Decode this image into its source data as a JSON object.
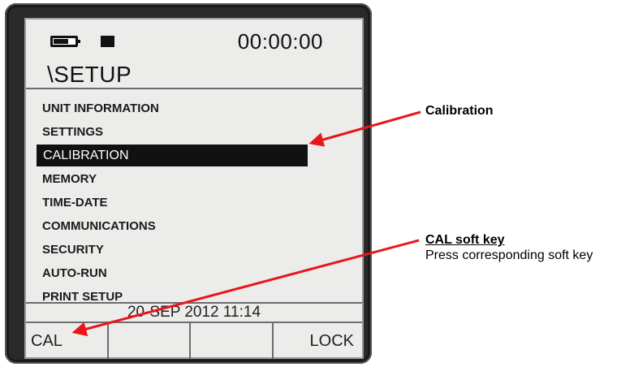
{
  "status": {
    "time": "00:00:00"
  },
  "screen": {
    "title": "\\SETUP"
  },
  "menu": {
    "items": [
      {
        "label": "UNIT INFORMATION"
      },
      {
        "label": "SETTINGS"
      },
      {
        "label": "CALIBRATION"
      },
      {
        "label": "MEMORY"
      },
      {
        "label": "TIME-DATE"
      },
      {
        "label": "COMMUNICATIONS"
      },
      {
        "label": "SECURITY"
      },
      {
        "label": "AUTO-RUN"
      },
      {
        "label": "PRINT SETUP"
      }
    ],
    "selected_label": "CALIBRATION"
  },
  "footer": {
    "datetime": "20-SEP 2012   11:14"
  },
  "softkeys": [
    {
      "label": "CAL"
    },
    {
      "label": ""
    },
    {
      "label": ""
    },
    {
      "label": "LOCK"
    }
  ],
  "annotations": {
    "calibration": {
      "title": "Calibration"
    },
    "cal_softkey": {
      "title": "CAL soft key",
      "subtitle": "Press corresponding soft key"
    }
  },
  "colors": {
    "arrow": "#e8161b",
    "screen_bg": "#ececea",
    "bezel": "#2a2a2a"
  },
  "icons": [
    "battery-icon",
    "status-block-icon",
    "arrow-icon"
  ]
}
